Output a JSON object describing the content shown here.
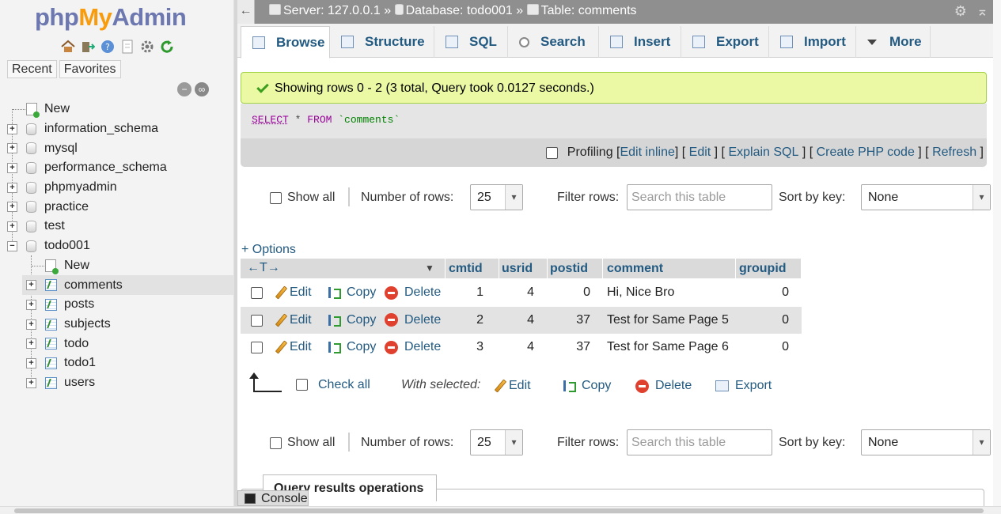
{
  "nav": {
    "logo": {
      "php": "php",
      "my": "My",
      "admin": "Admin"
    },
    "tabs": [
      "Recent",
      "Favorites"
    ],
    "tree": [
      {
        "label": "New",
        "kind": "new",
        "level": 0
      },
      {
        "label": "information_schema",
        "kind": "db",
        "level": 0
      },
      {
        "label": "mysql",
        "kind": "db",
        "level": 0
      },
      {
        "label": "performance_schema",
        "kind": "db",
        "level": 0
      },
      {
        "label": "phpmyadmin",
        "kind": "db",
        "level": 0
      },
      {
        "label": "practice",
        "kind": "db",
        "level": 0
      },
      {
        "label": "test",
        "kind": "db",
        "level": 0
      },
      {
        "label": "todo001",
        "kind": "db-open",
        "level": 0
      },
      {
        "label": "New",
        "kind": "new",
        "level": 1
      },
      {
        "label": "comments",
        "kind": "table",
        "level": 1,
        "selected": true
      },
      {
        "label": "posts",
        "kind": "table",
        "level": 1
      },
      {
        "label": "subjects",
        "kind": "table",
        "level": 1
      },
      {
        "label": "todo",
        "kind": "table",
        "level": 1
      },
      {
        "label": "todo1",
        "kind": "table",
        "level": 1
      },
      {
        "label": "users",
        "kind": "table",
        "level": 1
      }
    ]
  },
  "header": {
    "back": "←",
    "server": "Server: 127.0.0.1",
    "sep": "»",
    "database": "Database: todo001",
    "table": "Table: comments"
  },
  "tabs": [
    "Browse",
    "Structure",
    "SQL",
    "Search",
    "Insert",
    "Export",
    "Import",
    "More"
  ],
  "message": "Showing rows 0 - 2 (3 total, Query took 0.0127 seconds.)",
  "sql": {
    "select": "SELECT",
    "star": " * ",
    "from": "FROM",
    "table": " `comments`"
  },
  "profiling": {
    "label": "Profiling",
    "links": [
      "Edit inline",
      "Edit",
      "Explain SQL",
      "Create PHP code",
      "Refresh"
    ]
  },
  "navigation": {
    "show_all": "Show all",
    "num_rows_label": "Number of rows:",
    "num_rows": "25",
    "filter_label": "Filter rows:",
    "filter_placeholder": "Search this table",
    "sort_label": "Sort by key:",
    "sort_value": "None"
  },
  "options_link": "+ Options",
  "table": {
    "columns": [
      "cmtid",
      "usrid",
      "postid",
      "comment",
      "groupid"
    ],
    "action_labels": {
      "edit": "Edit",
      "copy": "Copy",
      "delete": "Delete"
    },
    "rows": [
      {
        "cmtid": "1",
        "usrid": "4",
        "postid": "0",
        "comment": "Hi, Nice Bro",
        "groupid": "0"
      },
      {
        "cmtid": "2",
        "usrid": "4",
        "postid": "37",
        "comment": "Test for Same Page 5",
        "groupid": "0"
      },
      {
        "cmtid": "3",
        "usrid": "4",
        "postid": "37",
        "comment": "Test for Same Page 6",
        "groupid": "0"
      }
    ]
  },
  "bulk": {
    "check_all": "Check all",
    "with_selected": "With selected:",
    "edit": "Edit",
    "copy": "Copy",
    "delete": "Delete",
    "export": "Export"
  },
  "query_results_ops": "Query results operations",
  "console": "Console"
}
